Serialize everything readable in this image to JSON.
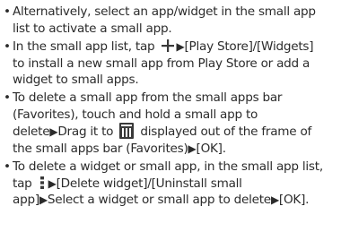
{
  "bullets": [
    {
      "lines": [
        "Alternatively, select an app/widget in the small app",
        "list to activate a small app."
      ]
    },
    {
      "line1_a": "In the small app list, tap ",
      "line1_b": "▶",
      "line1_c": "[Play Store]/[Widgets]",
      "line2": "to install a new small app from Play Store or add a",
      "line3": "widget to small apps."
    },
    {
      "line1": "To delete a small app from the small apps bar",
      "line2": "(Favorites), touch and hold a small app to",
      "line3_a": "delete",
      "line3_b": "▶",
      "line3_c": "Drag it to ",
      "line3_d": " displayed out of the frame of",
      "line4_a": "the small apps bar (Favorites)",
      "line4_b": "▶",
      "line4_c": "[OK]."
    },
    {
      "line1": "To delete a widget or small app, in the small app list,",
      "line2_a": "tap ",
      "line2_b": "▶",
      "line2_c": "[Delete widget]/[Uninstall small",
      "line3_a": "app]",
      "line3_b": "▶",
      "line3_c": "Select a widget or small app to delete",
      "line3_d": "▶",
      "line3_e": "[OK]."
    }
  ],
  "bullet_char": "•",
  "icons": {
    "plus": "plus-icon",
    "trash": "trash-icon",
    "menu": "kebab-menu-icon"
  }
}
